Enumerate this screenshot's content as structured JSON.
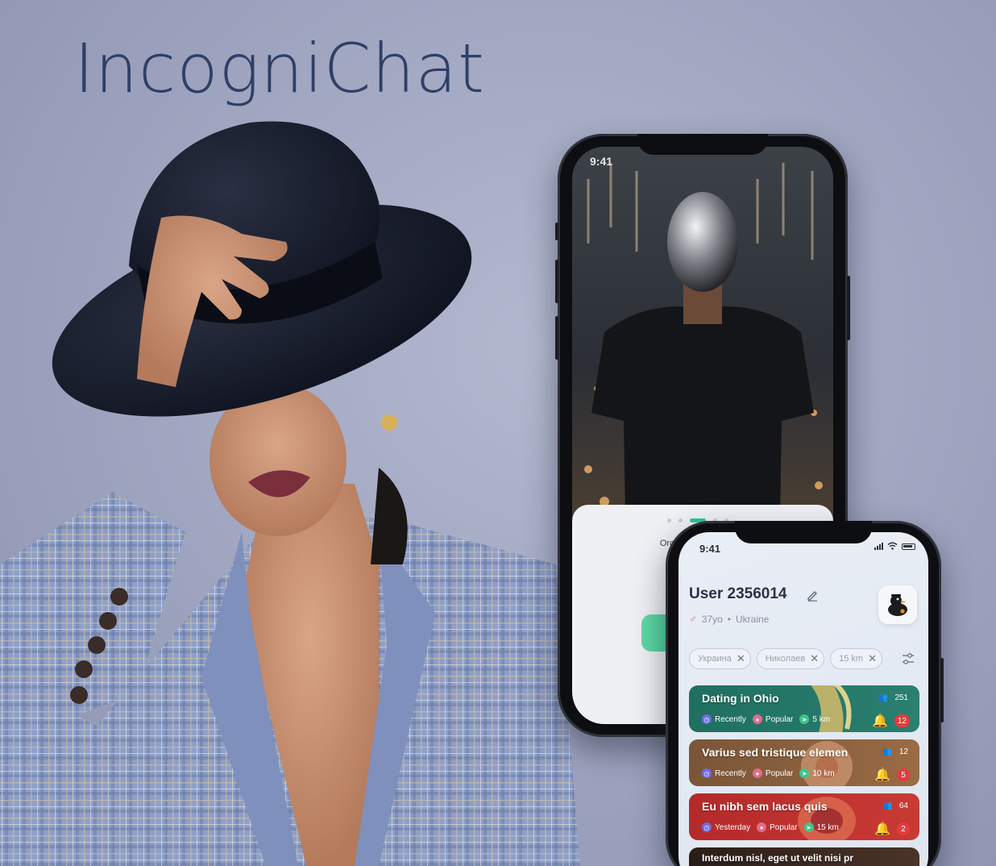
{
  "brand": {
    "title": "IncogniChat"
  },
  "onboarding": {
    "status_time": "9:41",
    "body_text": "Orci et vitae magna vi",
    "cta_label": "",
    "pager_dots": 5,
    "active_dot": 2
  },
  "profile_screen": {
    "status_time": "9:41",
    "user_name": "User 2356014",
    "gender_symbol": "♂",
    "age": "37yo",
    "separator": "•",
    "country": "Ukraine",
    "filters": [
      {
        "label": "Украина"
      },
      {
        "label": "Николаев"
      },
      {
        "label": "15 km"
      }
    ],
    "rooms": [
      {
        "title": "Dating in Ohio",
        "members": "251",
        "notifications": "12",
        "tags": [
          "Recently",
          "Popular",
          "5 km"
        ],
        "color": "#1f6f60"
      },
      {
        "title": "Varius sed tristique elemen",
        "members": "12",
        "notifications": "5",
        "tags": [
          "Recently",
          "Popular",
          "10 km"
        ],
        "color": "#7a5537"
      },
      {
        "title": "Eu nibh sem lacus quis",
        "members": "64",
        "notifications": "2",
        "tags": [
          "Yesterday",
          "Popular",
          "15 km"
        ],
        "color": "#b42a2a"
      },
      {
        "title": "Interdum nisl, eget ut velit nisi pr",
        "members": "",
        "notifications": "",
        "tags": [],
        "color": "#2a1d18"
      }
    ]
  },
  "colors": {
    "background": "#a7adc6",
    "title": "#2f3f66",
    "accent_green": "#2fc6a0",
    "badge_red": "#e53c3c"
  },
  "icons": [
    "edit-icon",
    "gender-male-icon",
    "duck-avatar-icon",
    "close-icon",
    "filter-sliders-icon",
    "members-icon",
    "bell-icon",
    "clock-icon",
    "flame-icon",
    "location-arrow-icon",
    "wifi-icon",
    "signal-icon",
    "battery-icon"
  ]
}
